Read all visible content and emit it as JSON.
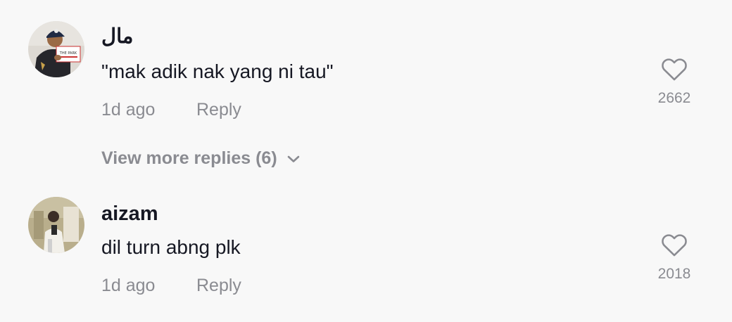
{
  "comments": [
    {
      "username": "مال",
      "text": "\"mak adik nak yang ni tau\"",
      "time": "1d ago",
      "reply_label": "Reply",
      "likes": "2662",
      "avatar_sign_text": "THE PARK"
    },
    {
      "username": "aizam",
      "text": "dil turn abng plk",
      "time": "1d ago",
      "reply_label": "Reply",
      "likes": "2018"
    }
  ],
  "view_more": {
    "label": "View more replies (6)",
    "icon": "chevron-down-icon"
  },
  "icons": {
    "like": "heart-outline-icon"
  },
  "colors": {
    "background": "#f8f8f8",
    "primary_text": "#161823",
    "secondary_text": "#8a8b91"
  }
}
